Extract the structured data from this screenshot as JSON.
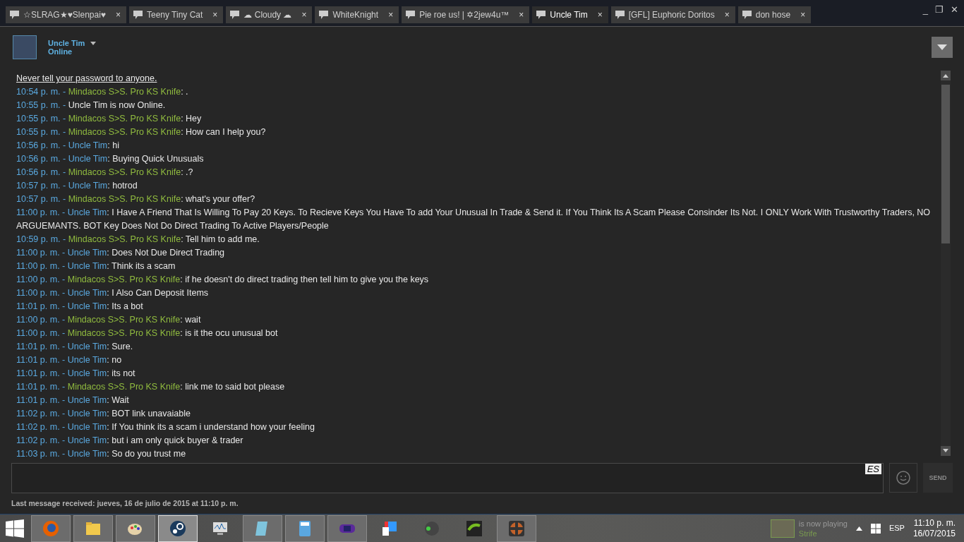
{
  "window": {
    "controls": [
      "_",
      "❐",
      "✕"
    ]
  },
  "tabs": [
    {
      "label": "☆SLRAG★♥Slenpai♥",
      "close": "×",
      "selected": false
    },
    {
      "label": "Teeny Tiny Cat",
      "close": "×",
      "selected": false
    },
    {
      "label": "☁ Cloudy ☁",
      "close": "×",
      "selected": false
    },
    {
      "label": "WhiteKnight",
      "close": "×",
      "selected": false
    },
    {
      "label": "Pie roe us! | ✡2jew4u™",
      "close": "×",
      "selected": false
    },
    {
      "label": "Uncle Tim",
      "close": "×",
      "selected": true
    },
    {
      "label": "[GFL] Euphoric Doritos",
      "close": "×",
      "selected": false
    },
    {
      "label": "don hose",
      "close": "×",
      "selected": false
    }
  ],
  "friend": {
    "name": "Uncle Tim",
    "status": "Online"
  },
  "chat": {
    "warning": "Never tell your password to anyone.",
    "messages": [
      {
        "kind": "message",
        "time": "10:54 p. m. -",
        "color": "#90bb3f",
        "sender": "Mindacos S>S. Pro KS Knife",
        "text": ": ."
      },
      {
        "kind": "status",
        "time": "10:55 p. m. -",
        "text": "Uncle Tim is now Online."
      },
      {
        "kind": "message",
        "time": "10:55 p. m. -",
        "color": "#90bb3f",
        "sender": "Mindacos S>S. Pro KS Knife",
        "text": ": Hey"
      },
      {
        "kind": "message",
        "time": "10:55 p. m. -",
        "color": "#90bb3f",
        "sender": "Mindacos S>S. Pro KS Knife",
        "text": ": How can I help you?"
      },
      {
        "kind": "message",
        "time": "10:56 p. m. -",
        "color": "#5aa9e0",
        "sender": "Uncle Tim",
        "text": ": hi"
      },
      {
        "kind": "message",
        "time": "10:56 p. m. -",
        "color": "#5aa9e0",
        "sender": "Uncle Tim",
        "text": ": Buying Quick Unusuals"
      },
      {
        "kind": "message",
        "time": "10:56 p. m. -",
        "color": "#90bb3f",
        "sender": "Mindacos S>S. Pro KS Knife",
        "text": ": .?"
      },
      {
        "kind": "message",
        "time": "10:57 p. m. -",
        "color": "#5aa9e0",
        "sender": "Uncle Tim",
        "text": ": hotrod"
      },
      {
        "kind": "message",
        "time": "10:57 p. m. -",
        "color": "#90bb3f",
        "sender": "Mindacos S>S. Pro KS Knife",
        "text": ": what's your offer?"
      },
      {
        "kind": "message",
        "time": "11:00 p. m. -",
        "color": "#5aa9e0",
        "sender": "Uncle Tim",
        "text": ": I Have A Friend That Is Willing To Pay 20 Keys. To Recieve Keys You Have To add Your Unusual In Trade & Send it. If You Think Its A Scam Please Consinder Its Not. I ONLY Work With Trustworthy Traders, NO ARGUEMANTS. BOT Key Does Not Do Direct Trading To Active Players/People"
      },
      {
        "kind": "message",
        "time": "10:59 p. m. -",
        "color": "#90bb3f",
        "sender": "Mindacos S>S. Pro KS Knife",
        "text": ": Tell him to add me."
      },
      {
        "kind": "message",
        "time": "11:00 p. m. -",
        "color": "#5aa9e0",
        "sender": "Uncle Tim",
        "text": ": Does Not Due Direct Trading"
      },
      {
        "kind": "message",
        "time": "11:00 p. m. -",
        "color": "#5aa9e0",
        "sender": "Uncle Tim",
        "text": ": Think its a scam"
      },
      {
        "kind": "message",
        "time": "11:00 p. m. -",
        "color": "#90bb3f",
        "sender": "Mindacos S>S. Pro KS Knife",
        "text": ": if he doesn't do direct trading then tell him to give you the keys"
      },
      {
        "kind": "message",
        "time": "11:00 p. m. -",
        "color": "#5aa9e0",
        "sender": "Uncle Tim",
        "text": ": I Also Can Deposit Items"
      },
      {
        "kind": "message",
        "time": "11:01 p. m. -",
        "color": "#5aa9e0",
        "sender": "Uncle Tim",
        "text": ": Its a bot"
      },
      {
        "kind": "message",
        "time": "11:00 p. m. -",
        "color": "#90bb3f",
        "sender": "Mindacos S>S. Pro KS Knife",
        "text": ": wait"
      },
      {
        "kind": "message",
        "time": "11:00 p. m. -",
        "color": "#90bb3f",
        "sender": "Mindacos S>S. Pro KS Knife",
        "text": ": is it the ocu unusual bot"
      },
      {
        "kind": "message",
        "time": "11:01 p. m. -",
        "color": "#5aa9e0",
        "sender": "Uncle Tim",
        "text": ": Sure."
      },
      {
        "kind": "message",
        "time": "11:01 p. m. -",
        "color": "#5aa9e0",
        "sender": "Uncle Tim",
        "text": ": no"
      },
      {
        "kind": "message",
        "time": "11:01 p. m. -",
        "color": "#5aa9e0",
        "sender": "Uncle Tim",
        "text": ": its not"
      },
      {
        "kind": "message",
        "time": "11:01 p. m. -",
        "color": "#90bb3f",
        "sender": "Mindacos S>S. Pro KS Knife",
        "text": ": link me to said bot please"
      },
      {
        "kind": "message",
        "time": "11:01 p. m. -",
        "color": "#5aa9e0",
        "sender": "Uncle Tim",
        "text": ": Wait"
      },
      {
        "kind": "message",
        "time": "11:02 p. m. -",
        "color": "#5aa9e0",
        "sender": "Uncle Tim",
        "text": ": BOT link unavaiable"
      },
      {
        "kind": "message",
        "time": "11:02 p. m. -",
        "color": "#5aa9e0",
        "sender": "Uncle Tim",
        "text": ": If You think its a scam i understand how your feeling"
      },
      {
        "kind": "message",
        "time": "11:02 p. m. -",
        "color": "#5aa9e0",
        "sender": "Uncle Tim",
        "text": ": but i am only quick buyer & trader"
      },
      {
        "kind": "message",
        "time": "11:03 p. m. -",
        "color": "#5aa9e0",
        "sender": "Uncle Tim",
        "text": ": So do you trust me"
      }
    ]
  },
  "input": {
    "language": "ES",
    "send_label": "SEND"
  },
  "last_message": "Last message received: jueves, 16 de julio de 2015 at 11:10 p. m.",
  "taskbar": {
    "apps": [
      {
        "open": true,
        "active": false
      },
      {
        "open": true,
        "active": false
      },
      {
        "open": true,
        "active": false
      },
      {
        "open": true,
        "active": true
      },
      {
        "open": false,
        "active": false
      },
      {
        "open": true,
        "active": false
      },
      {
        "open": true,
        "active": false
      },
      {
        "open": true,
        "active": false
      },
      {
        "open": false,
        "active": false
      },
      {
        "open": false,
        "active": false
      },
      {
        "open": false,
        "active": false
      },
      {
        "open": true,
        "active": false
      }
    ],
    "notification": {
      "text": "is now playing",
      "game": "Strife"
    },
    "language": "ESP",
    "time": "11:10 p. m.",
    "date": "16/07/2015"
  }
}
